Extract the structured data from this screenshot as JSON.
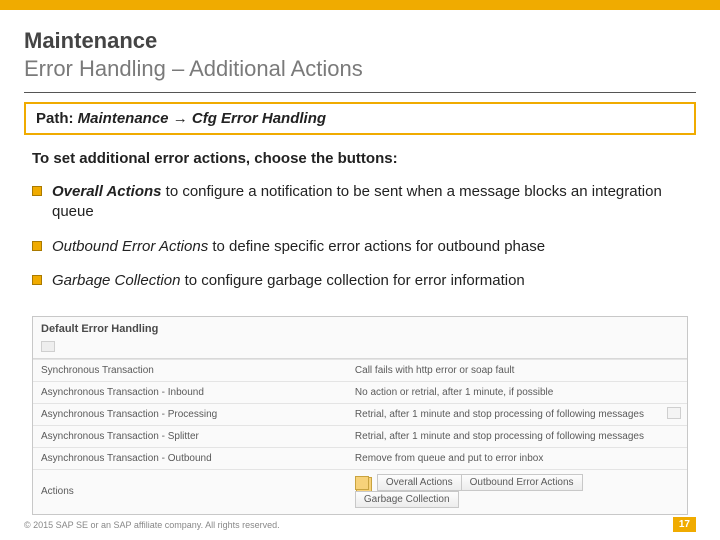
{
  "title": {
    "main": "Maintenance",
    "sub": "Error Handling – Additional Actions"
  },
  "path": {
    "label": "Path:  ",
    "value": "Maintenance → Cfg Error Handling"
  },
  "intro": "To set additional error actions, choose the buttons:",
  "bullets": [
    {
      "term": "Overall Actions",
      "rest": " to configure a notification to be sent when a message blocks an integration queue"
    },
    {
      "term": "Outbound Error Actions",
      "rest": " to define specific error actions for outbound phase"
    },
    {
      "term": "Garbage Collection",
      "rest": " to configure garbage collection for error information"
    }
  ],
  "screenshot": {
    "panel_title": "Default Error Handling",
    "rows": [
      {
        "name": "Synchronous Transaction",
        "action": "Call fails with http error or soap fault"
      },
      {
        "name": "Asynchronous Transaction - Inbound",
        "action": "No action or retrial, after 1 minute, if possible"
      },
      {
        "name": "Asynchronous Transaction - Processing",
        "action": "Retrial, after 1 minute and stop processing of following messages"
      },
      {
        "name": "Asynchronous Transaction - Splitter",
        "action": "Retrial, after 1 minute and stop processing of following messages"
      },
      {
        "name": "Asynchronous Transaction - Outbound",
        "action": "Remove from queue and put to error inbox"
      }
    ],
    "actions_label": "Actions",
    "buttons": {
      "overall": "Overall Actions",
      "outbound": "Outbound Error Actions",
      "garbage": "Garbage Collection"
    }
  },
  "footer": {
    "copyright": "© 2015 SAP SE or an SAP affiliate company. All rights reserved.",
    "page": "17"
  }
}
